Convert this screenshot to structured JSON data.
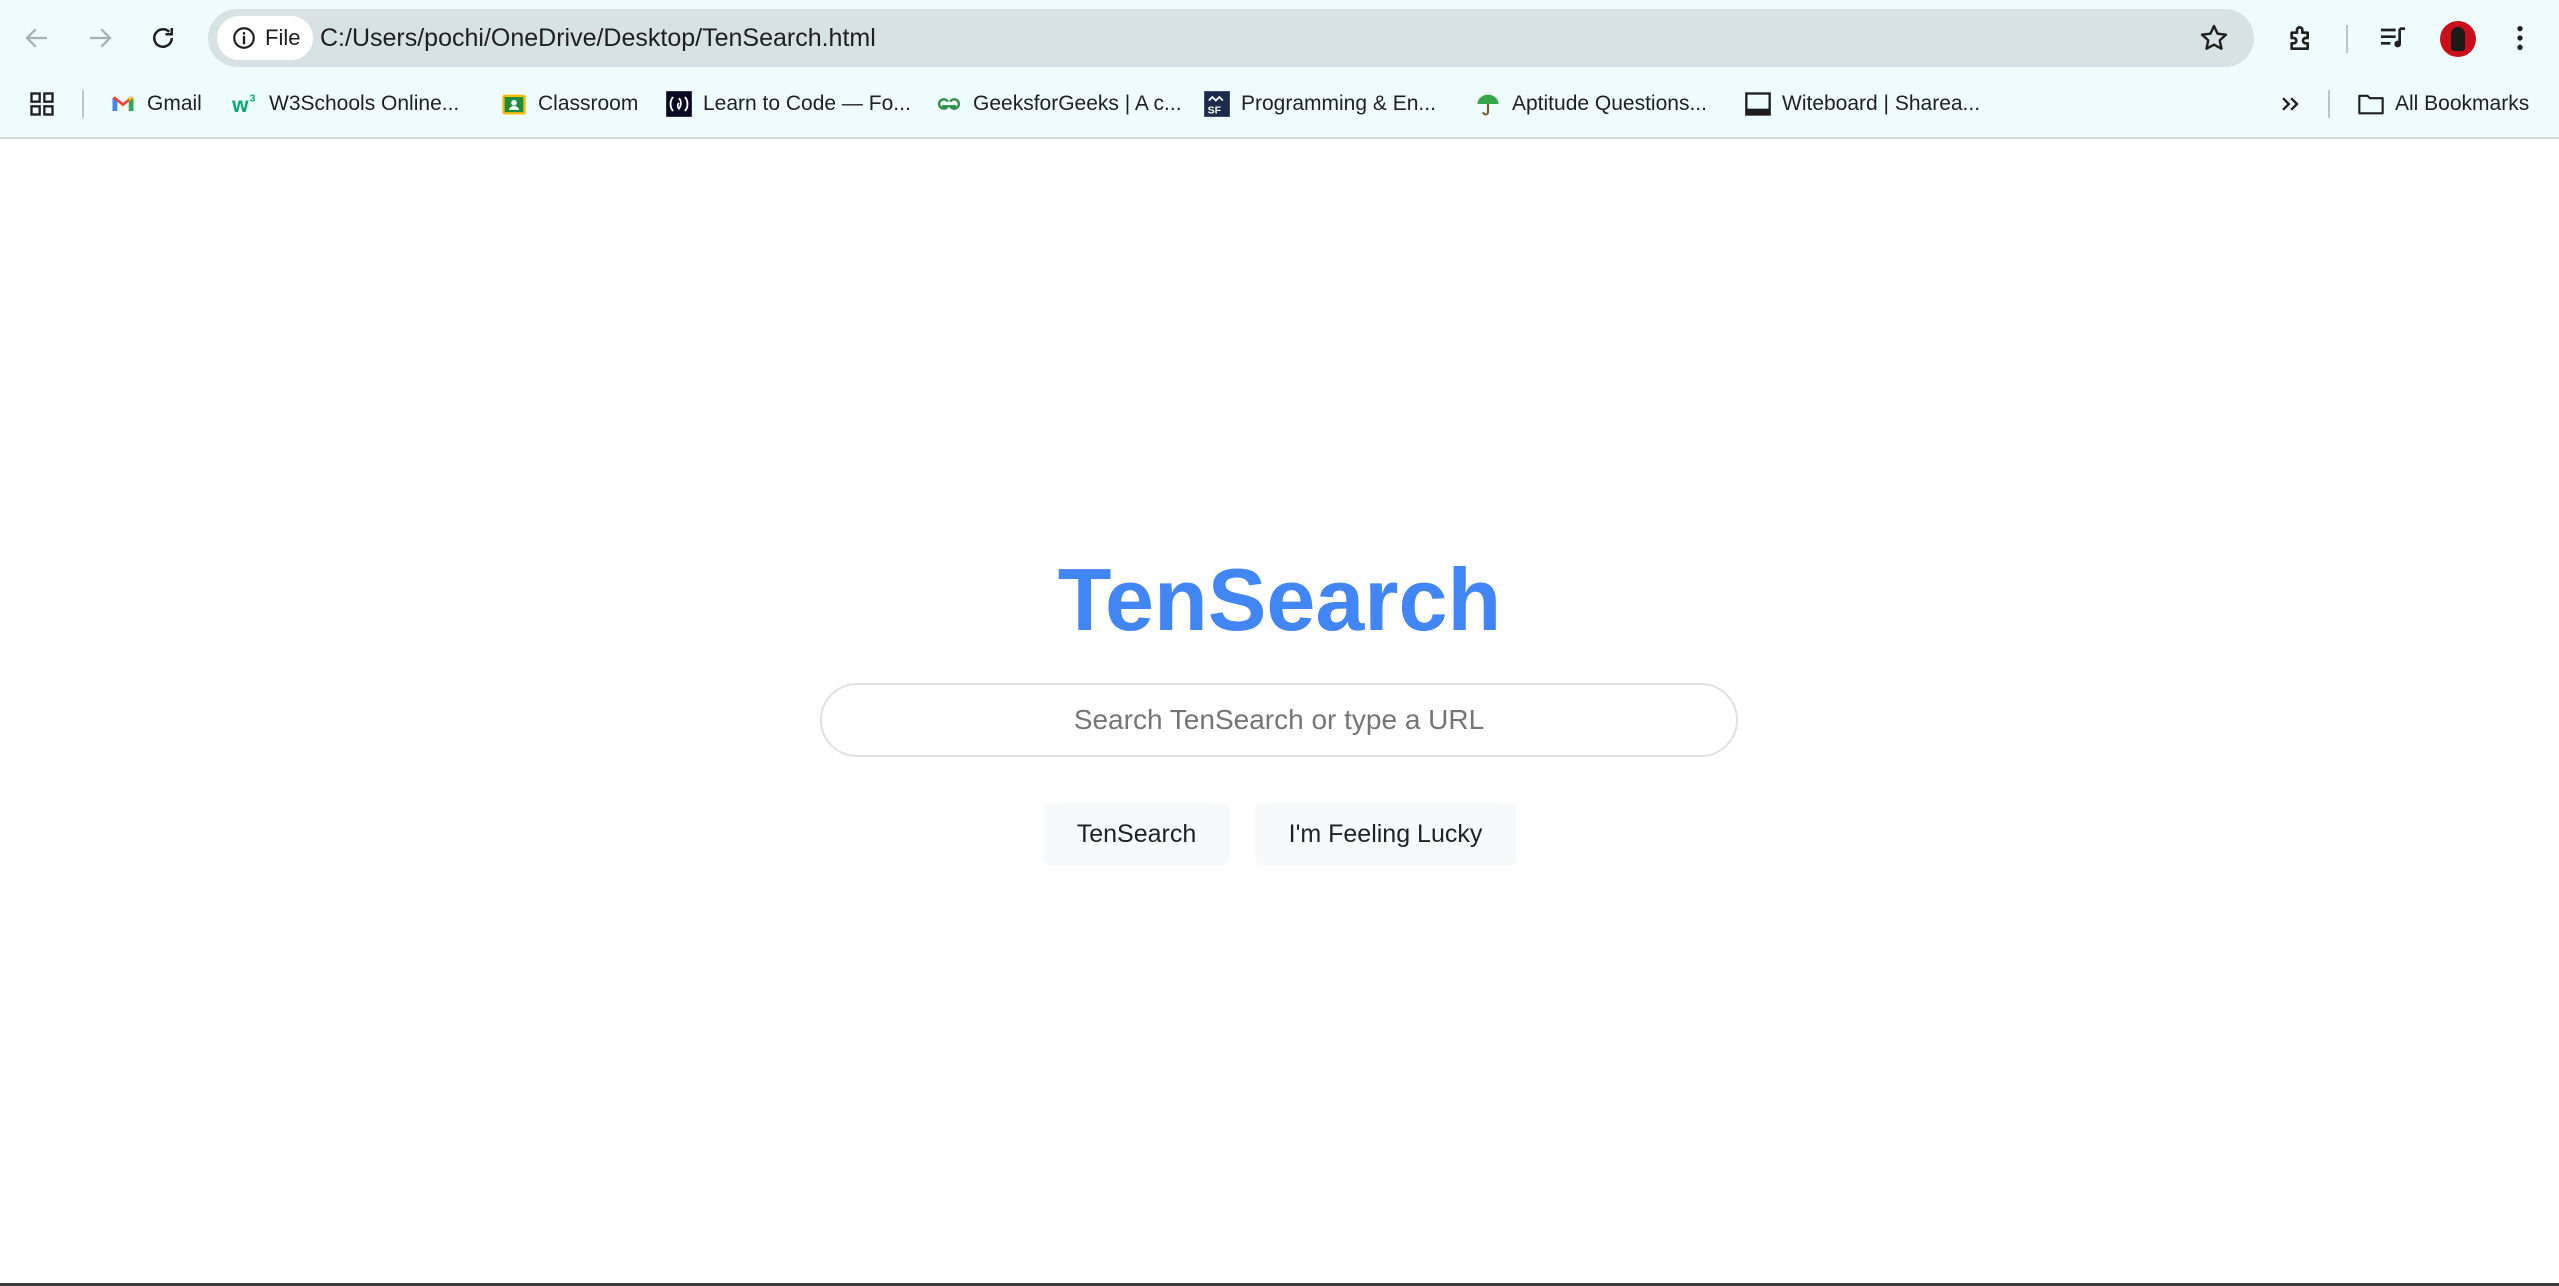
{
  "browser": {
    "url": "C:/Users/pochi/OneDrive/Desktop/TenSearch.html",
    "site_chip_label": "File",
    "icons": {
      "back": "arrow-left-icon",
      "forward": "arrow-right-icon",
      "reload": "reload-icon",
      "site_info": "info-icon",
      "bookmark_star": "star-icon",
      "extensions": "puzzle-icon",
      "media": "playlist-icon",
      "menu": "kebab-menu-icon"
    }
  },
  "bookmarks": {
    "items": [
      {
        "label": "Gmail",
        "icon": "gmail-icon"
      },
      {
        "label": "W3Schools Online...",
        "icon": "w3schools-icon"
      },
      {
        "label": "Classroom",
        "icon": "classroom-icon"
      },
      {
        "label": "Learn to Code — Fo...",
        "icon": "freecodecamp-icon"
      },
      {
        "label": "GeeksforGeeks | A c...",
        "icon": "geeksforgeeks-icon"
      },
      {
        "label": "Programming & En...",
        "icon": "sf-icon"
      },
      {
        "label": "Aptitude Questions...",
        "icon": "umbrella-icon"
      },
      {
        "label": "Witeboard | Sharea...",
        "icon": "witeboard-icon"
      }
    ],
    "all_bookmarks_label": "All Bookmarks"
  },
  "page": {
    "logo": "TenSearch",
    "search_placeholder": "Search TenSearch or type a URL",
    "search_button": "TenSearch",
    "lucky_button": "I'm Feeling Lucky"
  },
  "colors": {
    "logo": "#4285f4",
    "chrome_bg": "#eefcfd",
    "omnibox_bg": "#d6e2e3"
  }
}
